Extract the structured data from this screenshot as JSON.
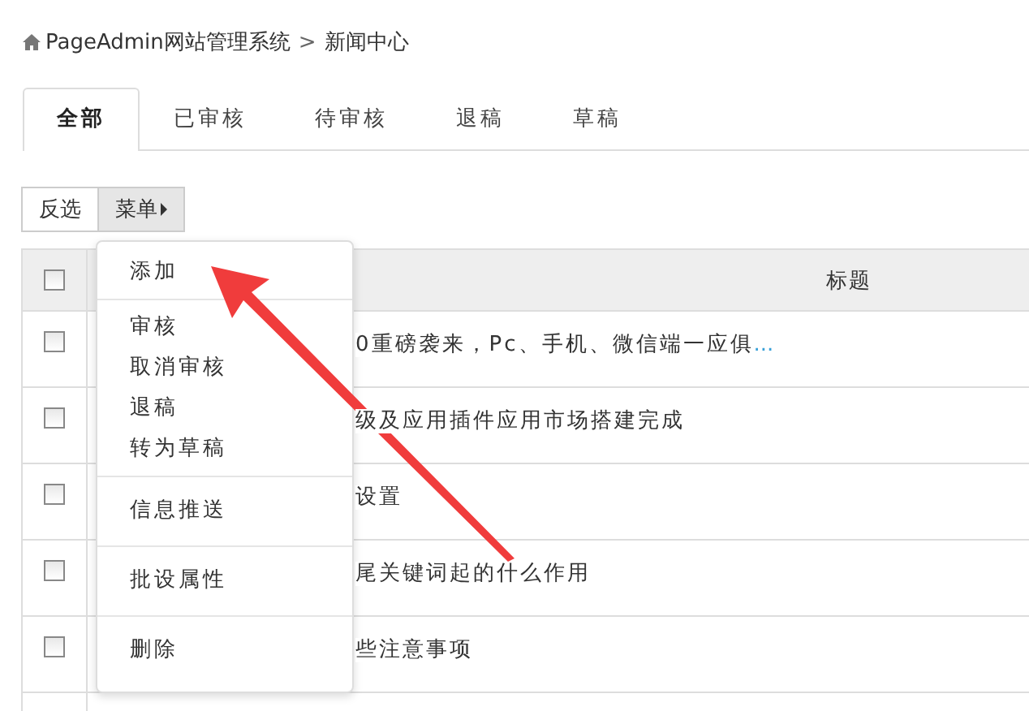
{
  "breadcrumb": {
    "items": [
      "PageAdmin网站管理系统",
      "新闻中心"
    ],
    "separator": ">"
  },
  "tabs": [
    {
      "label": "全部",
      "selected": true
    },
    {
      "label": "已审核",
      "selected": false
    },
    {
      "label": "待审核",
      "selected": false
    },
    {
      "label": "退稿",
      "selected": false
    },
    {
      "label": "草稿",
      "selected": false
    }
  ],
  "toolbar": [
    {
      "label": "反选",
      "kind": "plain",
      "expanded": false
    },
    {
      "label": "菜单",
      "kind": "dropdown",
      "expanded": true
    }
  ],
  "menu": [
    [
      "添加"
    ],
    [
      "审核",
      "取消审核",
      "退稿",
      "转为草稿"
    ],
    [
      "信息推送"
    ],
    [
      "批设属性"
    ],
    [
      "删除"
    ]
  ],
  "table": {
    "header": {
      "checked": false,
      "title": "标题"
    },
    "rows": [
      {
        "checked": false,
        "title": "0重磅袭来，Pc、手机、微信端一应俱",
        "more": "..."
      },
      {
        "checked": false,
        "title": "级及应用插件应用市场搭建完成"
      },
      {
        "checked": false,
        "title": "设置"
      },
      {
        "checked": false,
        "title": "尾关键词起的什么作用"
      },
      {
        "checked": false,
        "title": "些注意事项"
      }
    ]
  }
}
